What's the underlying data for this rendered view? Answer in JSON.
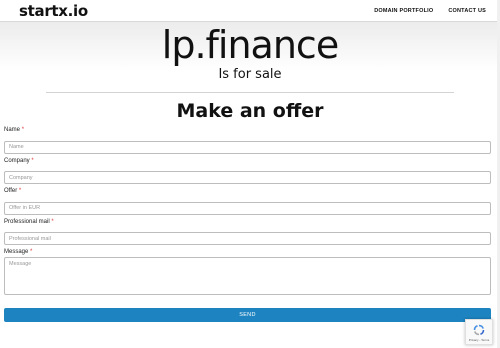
{
  "header": {
    "logo": "startx.io",
    "nav": [
      {
        "label": "DOMAIN PORTFOLIO"
      },
      {
        "label": "CONTACT US"
      }
    ]
  },
  "hero": {
    "domain": "lp.finance",
    "subtitle": "Is for sale"
  },
  "offer": {
    "title": "Make an offer",
    "fields": [
      {
        "label": "Name",
        "placeholder": "Name"
      },
      {
        "label": "Company",
        "placeholder": "Company"
      },
      {
        "label": "Offer",
        "placeholder": "Offer in EUR"
      },
      {
        "label": "Professional mail",
        "placeholder": "Professional mail"
      },
      {
        "label": "Message",
        "placeholder": "Message"
      }
    ],
    "required_mark": "*",
    "submit_label": "SEND"
  },
  "recaptcha": {
    "links": "Privacy - Terms"
  },
  "colors": {
    "accent": "#1e84c1",
    "required": "#dd3333"
  }
}
